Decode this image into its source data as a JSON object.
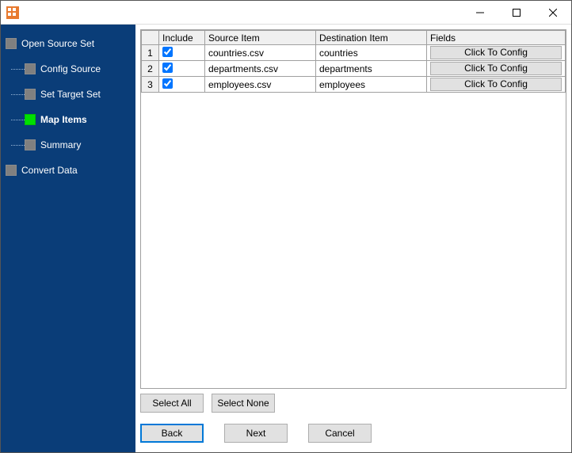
{
  "sidebar": {
    "items": [
      {
        "label": "Open Source Set",
        "level": 0,
        "active": false
      },
      {
        "label": "Config Source",
        "level": 1,
        "active": false
      },
      {
        "label": "Set Target Set",
        "level": 1,
        "active": false
      },
      {
        "label": "Map Items",
        "level": 1,
        "active": true
      },
      {
        "label": "Summary",
        "level": 1,
        "active": false
      },
      {
        "label": "Convert Data",
        "level": 0,
        "active": false
      }
    ]
  },
  "grid": {
    "headers": {
      "row": "",
      "include": "Include",
      "source": "Source Item",
      "destination": "Destination Item",
      "fields": "Fields"
    },
    "fields_button_label": "Click To Config",
    "rows": [
      {
        "n": "1",
        "include": true,
        "source": "countries.csv",
        "destination": "countries"
      },
      {
        "n": "2",
        "include": true,
        "source": "departments.csv",
        "destination": "departments"
      },
      {
        "n": "3",
        "include": true,
        "source": "employees.csv",
        "destination": "employees"
      }
    ]
  },
  "buttons": {
    "select_all": "Select All",
    "select_none": "Select None",
    "back": "Back",
    "next": "Next",
    "cancel": "Cancel"
  }
}
